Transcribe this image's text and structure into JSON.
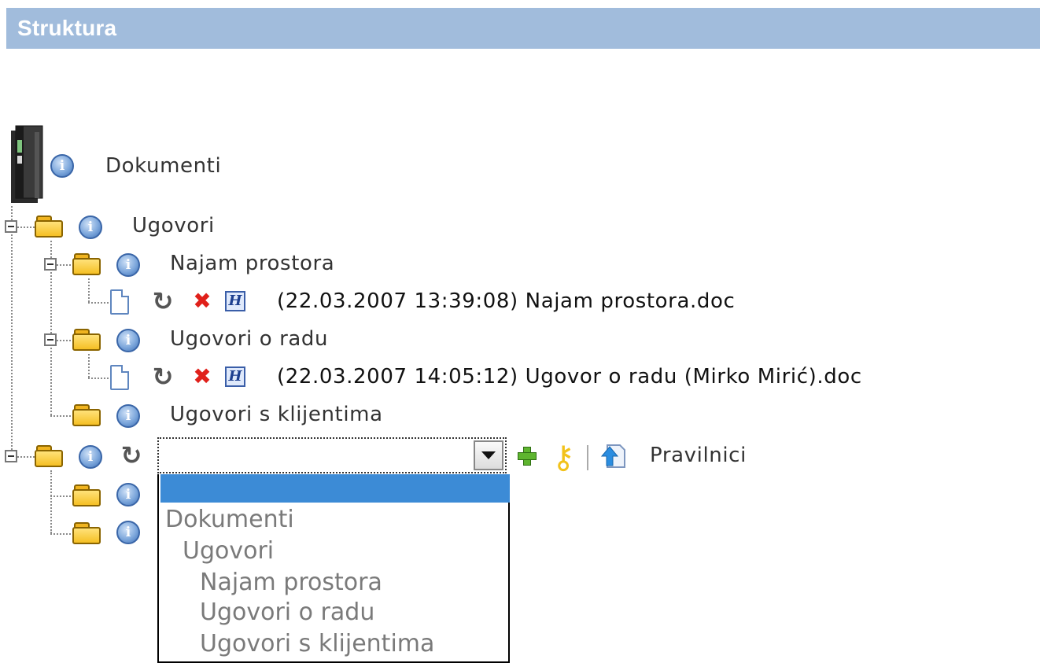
{
  "header": {
    "title": "Struktura"
  },
  "tree": {
    "root": {
      "label": "Dokumenti"
    },
    "ugovori": {
      "label": "Ugovori",
      "children": [
        {
          "label": "Najam prostora",
          "file": "(22.03.2007 13:39:08) Najam prostora.doc"
        },
        {
          "label": "Ugovori o radu",
          "file": "(22.03.2007 14:05:12) Ugovor o radu (Mirko Mirić).doc"
        },
        {
          "label": "Ugovori s klijentima"
        }
      ]
    },
    "pravilnici": {
      "label": "Pravilnici"
    }
  },
  "combo": {
    "value": "",
    "options": [
      "",
      "Dokumenti",
      "Ugovori",
      "Najam prostora",
      "Ugovori o radu",
      "Ugovori s klijentima"
    ]
  },
  "icons": {
    "info": "info-icon",
    "folder": "folder-icon",
    "file": "file-icon",
    "refresh": "refresh-icon",
    "delete": "delete-icon",
    "history": "history-icon",
    "add": "add-icon",
    "key": "key-icon",
    "upload": "upload-icon"
  }
}
